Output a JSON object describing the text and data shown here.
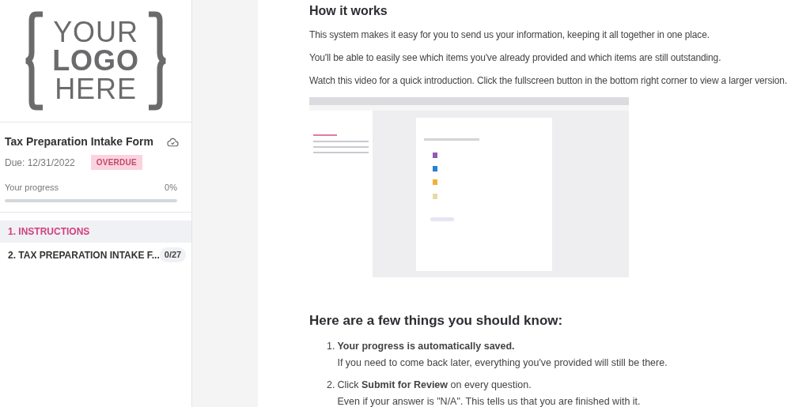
{
  "logo": {
    "lines": [
      "YOUR",
      "LOGO",
      "HERE"
    ]
  },
  "form": {
    "title": "Tax Preparation Intake Form",
    "due": "Due: 12/31/2022",
    "status": "OVERDUE",
    "progress_label": "Your progress",
    "progress_value": "0%",
    "level": 0
  },
  "sections": [
    {
      "label": "1. INSTRUCTIONS",
      "selected": true
    },
    {
      "label": "2. TAX PREPARATION INTAKE F...",
      "count": "0/27",
      "selected": false
    }
  ],
  "content": {
    "heading": "How it works",
    "paragraphs": [
      "This system makes it easy for you to send us your information, keeping it all together in one place.",
      "You'll be able to easily see which items you've already provided and which items are still outstanding.",
      "Watch this video for a quick introduction. Click the fullscreen button in the bottom right corner to view a larger version."
    ],
    "tips_heading": "Here are a few things you should know:",
    "tips": [
      {
        "number": "1.",
        "title": "**Your progress is automatically saved.**",
        "detail": "If you need to come back later, everything you've provided will still be there."
      },
      {
        "number": "2.",
        "title": "Click **Submit for Review** on every question.",
        "detail": "Even if your answer is \"N/A\". This tells us that you are finished with it."
      }
    ]
  }
}
